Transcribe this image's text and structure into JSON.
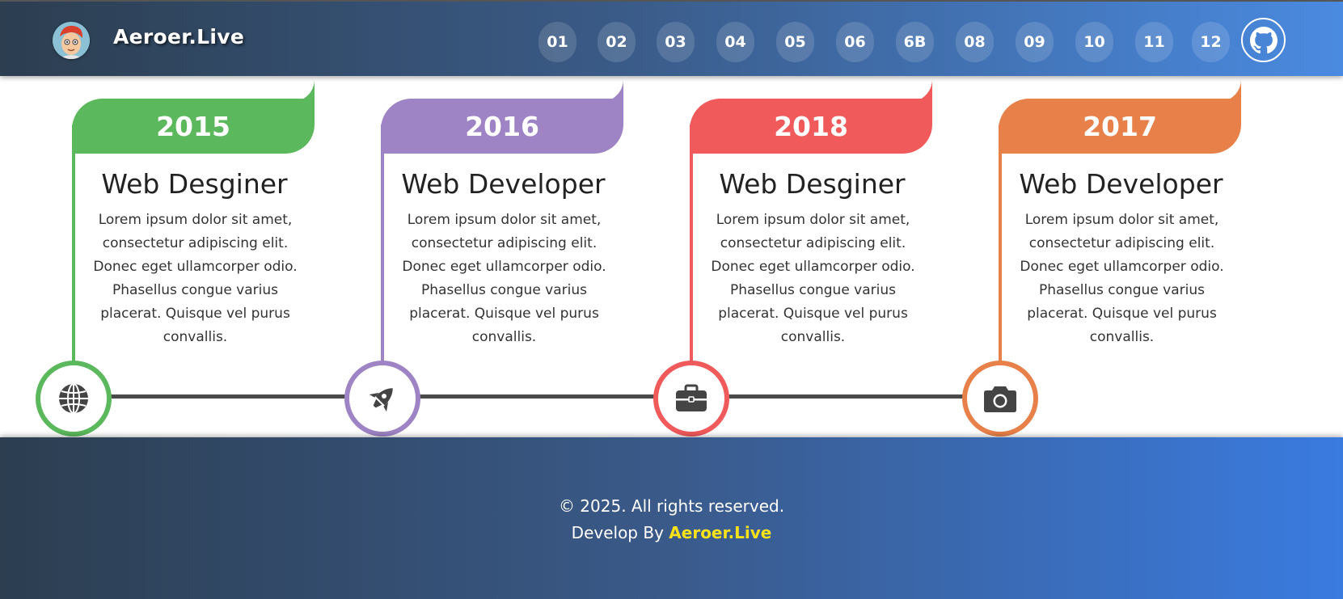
{
  "header": {
    "brand": "Aeroer.Live",
    "nav": [
      "01",
      "02",
      "03",
      "04",
      "05",
      "06",
      "6B",
      "08",
      "09",
      "10",
      "11",
      "12"
    ],
    "github_icon": "github-icon"
  },
  "timeline": [
    {
      "year": "2015",
      "title": "Web Desginer",
      "color": "#5cb85c",
      "icon": "globe-icon",
      "desc": "Lorem ipsum dolor sit amet, consectetur adipiscing elit. Donec eget ullamcorper odio. Phasellus congue varius placerat. Quisque vel purus convallis."
    },
    {
      "year": "2016",
      "title": "Web Developer",
      "color": "#9e84c4",
      "icon": "rocket-icon",
      "desc": "Lorem ipsum dolor sit amet, consectetur adipiscing elit. Donec eget ullamcorper odio. Phasellus congue varius placerat. Quisque vel purus convallis."
    },
    {
      "year": "2018",
      "title": "Web Desginer",
      "color": "#f05a5b",
      "icon": "briefcase-icon",
      "desc": "Lorem ipsum dolor sit amet, consectetur adipiscing elit. Donec eget ullamcorper odio. Phasellus congue varius placerat. Quisque vel purus convallis."
    },
    {
      "year": "2017",
      "title": "Web Developer",
      "color": "#e8804a",
      "icon": "camera-icon",
      "desc": "Lorem ipsum dolor sit amet, consectetur adipiscing elit. Donec eget ullamcorper odio. Phasellus congue varius placerat. Quisque vel purus convallis."
    }
  ],
  "footer": {
    "copyright": "© 2025. All rights reserved.",
    "develop_prefix": "Develop By ",
    "develop_name": "Aeroer.Live"
  }
}
